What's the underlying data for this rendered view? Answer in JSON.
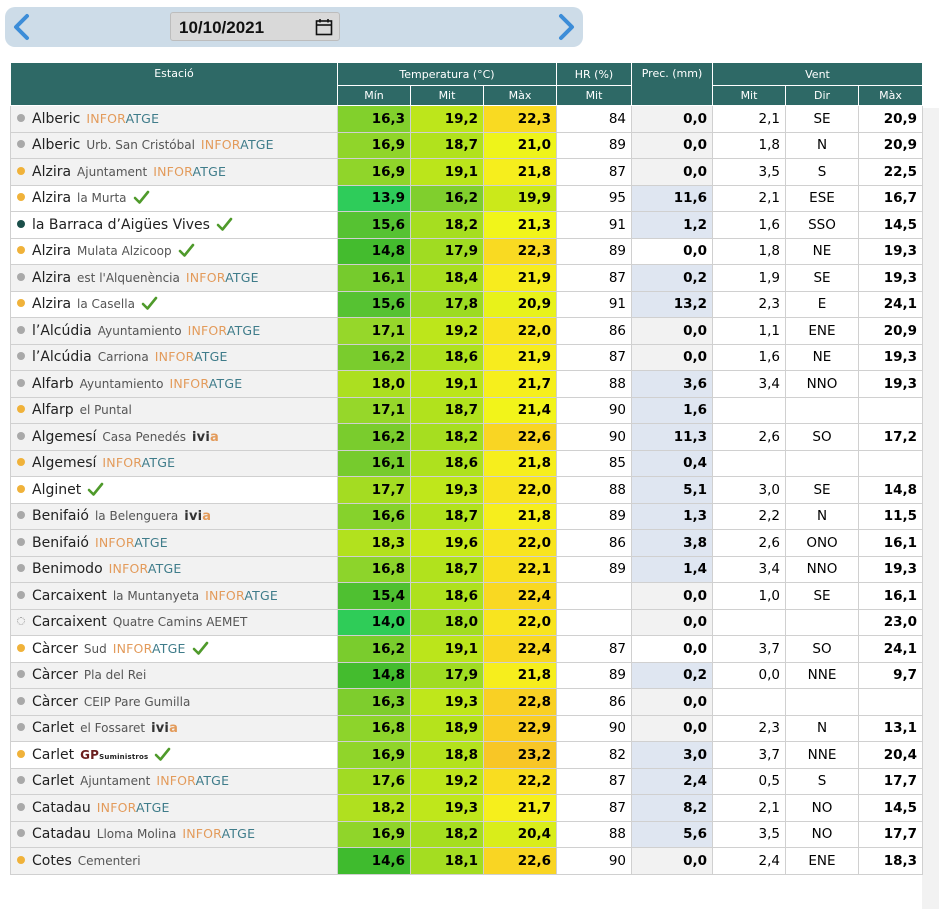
{
  "date_picker": {
    "value": "10/10/2021",
    "prev_icon": "chevron-left-icon",
    "next_icon": "chevron-right-icon",
    "calendar_icon": "calendar-icon"
  },
  "colors": {
    "header": "#2e6966",
    "dot_grey": "#a9a9a9",
    "dot_orange": "#f0b23a",
    "dot_teal": "#1b4f4a",
    "check": "#4f9a2b",
    "prec_bg": "#dfe6f1"
  },
  "table": {
    "headers": {
      "station": "Estació",
      "temp": "Temperatura (°C)",
      "hr": "HR (%)",
      "prec": "Prec. (mm)",
      "wind": "Vent"
    },
    "subheaders": {
      "tmin": "Mín",
      "tmid": "Mit",
      "tmax": "Màx",
      "hr_mid": "Mit",
      "wind_mid": "Mit",
      "wind_dir": "Dir",
      "wind_max": "Màx"
    },
    "rows": [
      {
        "name": "Alberic",
        "sub": "",
        "net": "infor",
        "check": false,
        "dot": "grey",
        "tmin": "16,3",
        "tmid": "19,2",
        "tmax": "22,3",
        "hr": "84",
        "prec": "0,0",
        "wmid": "2,1",
        "wdir": "SE",
        "wmax": "20,9",
        "tmin_bg": "#82d02c",
        "tmid_bg": "#bde61b",
        "tmax_bg": "#f9da22",
        "prec_hl": false
      },
      {
        "name": "Alberic",
        "sub": "Urb. San Cristóbal",
        "net": "infor",
        "check": false,
        "dot": "grey",
        "tmin": "16,9",
        "tmid": "18,7",
        "tmax": "21,0",
        "hr": "89",
        "prec": "0,0",
        "wmid": "1,8",
        "wdir": "N",
        "wmax": "20,9",
        "tmin_bg": "#90d52a",
        "tmid_bg": "#b1e21d",
        "tmax_bg": "#eef41a",
        "prec_hl": false
      },
      {
        "name": "Alzira",
        "sub": "Ajuntament",
        "net": "infor",
        "check": false,
        "dot": "orange",
        "tmin": "16,9",
        "tmid": "19,1",
        "tmax": "21,8",
        "hr": "87",
        "prec": "0,0",
        "wmid": "3,5",
        "wdir": "S",
        "wmax": "22,5",
        "tmin_bg": "#90d52a",
        "tmid_bg": "#bbe51b",
        "tmax_bg": "#f6ee1d",
        "prec_hl": false
      },
      {
        "name": "Alzira",
        "sub": "la Murta",
        "net": "",
        "check": true,
        "dot": "orange",
        "tmin": "13,9",
        "tmid": "16,2",
        "tmax": "19,9",
        "hr": "95",
        "prec": "11,6",
        "wmid": "2,1",
        "wdir": "ESE",
        "wmax": "16,7",
        "tmin_bg": "#2ecc5a",
        "tmid_bg": "#80cf2d",
        "tmax_bg": "#cbe91a",
        "prec_hl": true
      },
      {
        "name": "la Barraca d’Aigües Vives",
        "sub": "",
        "net": "",
        "check": true,
        "dot": "teal",
        "tmin": "15,6",
        "tmid": "18,2",
        "tmax": "21,3",
        "hr": "91",
        "prec": "1,2",
        "wmid": "1,6",
        "wdir": "SSO",
        "wmax": "14,5",
        "tmin_bg": "#56c232",
        "tmid_bg": "#a6de20",
        "tmax_bg": "#f1f51a",
        "prec_hl": true
      },
      {
        "name": "Alzira",
        "sub": "Mulata Alzicoop",
        "net": "",
        "check": true,
        "dot": "orange",
        "tmin": "14,8",
        "tmid": "17,9",
        "tmax": "22,3",
        "hr": "89",
        "prec": "0,0",
        "wmid": "1,8",
        "wdir": "NE",
        "wmax": "19,3",
        "tmin_bg": "#44bc2e",
        "tmid_bg": "#a0dc22",
        "tmax_bg": "#f9da22",
        "prec_hl": false
      },
      {
        "name": "Alzira",
        "sub": "est l'Alquenència",
        "net": "infor",
        "check": false,
        "dot": "grey",
        "tmin": "16,1",
        "tmid": "18,4",
        "tmax": "21,9",
        "hr": "87",
        "prec": "0,2",
        "wmid": "1,9",
        "wdir": "SE",
        "wmax": "19,3",
        "tmin_bg": "#76cb2d",
        "tmid_bg": "#a9df1f",
        "tmax_bg": "#f7ec1e",
        "prec_hl": true
      },
      {
        "name": "Alzira",
        "sub": "la Casella",
        "net": "",
        "check": true,
        "dot": "orange",
        "tmin": "15,6",
        "tmid": "17,8",
        "tmax": "20,9",
        "hr": "91",
        "prec": "13,2",
        "wmid": "2,3",
        "wdir": "E",
        "wmax": "24,1",
        "tmin_bg": "#56c232",
        "tmid_bg": "#9cdb22",
        "tmax_bg": "#e8f21a",
        "prec_hl": true
      },
      {
        "name": "l’Alcúdia",
        "sub": "Ayuntamiento",
        "net": "infor",
        "check": false,
        "dot": "grey",
        "tmin": "17,1",
        "tmid": "19,2",
        "tmax": "22,0",
        "hr": "86",
        "prec": "0,0",
        "wmid": "1,1",
        "wdir": "ENE",
        "wmax": "20,9",
        "tmin_bg": "#96d72a",
        "tmid_bg": "#bde61b",
        "tmax_bg": "#f8e41f",
        "prec_hl": false
      },
      {
        "name": "l’Alcúdia",
        "sub": "Carriona",
        "net": "infor",
        "check": false,
        "dot": "grey",
        "tmin": "16,2",
        "tmid": "18,6",
        "tmax": "21,9",
        "hr": "87",
        "prec": "0,0",
        "wmid": "1,6",
        "wdir": "NE",
        "wmax": "19,3",
        "tmin_bg": "#7acc2d",
        "tmid_bg": "#aee11e",
        "tmax_bg": "#f7ec1e",
        "prec_hl": false
      },
      {
        "name": "Alfarb",
        "sub": "Ayuntamiento",
        "net": "infor",
        "check": false,
        "dot": "grey",
        "tmin": "18,0",
        "tmid": "19,1",
        "tmax": "21,7",
        "hr": "88",
        "prec": "3,6",
        "wmid": "3,4",
        "wdir": "NNO",
        "wmax": "19,3",
        "tmin_bg": "#acdf20",
        "tmid_bg": "#bbe51b",
        "tmax_bg": "#f6ef1c",
        "prec_hl": true
      },
      {
        "name": "Alfarp",
        "sub": "el Puntal",
        "net": "",
        "check": false,
        "dot": "orange",
        "tmin": "17,1",
        "tmid": "18,7",
        "tmax": "21,4",
        "hr": "90",
        "prec": "1,6",
        "wmid": "",
        "wdir": "",
        "wmax": "",
        "tmin_bg": "#96d72a",
        "tmid_bg": "#b1e21d",
        "tmax_bg": "#f2f41a",
        "prec_hl": true
      },
      {
        "name": "Algemesí",
        "sub": "Casa Penedés",
        "net": "ivia",
        "check": false,
        "dot": "grey",
        "tmin": "16,2",
        "tmid": "18,2",
        "tmax": "22,6",
        "hr": "90",
        "prec": "11,3",
        "wmid": "2,6",
        "wdir": "SO",
        "wmax": "17,2",
        "tmin_bg": "#7acc2d",
        "tmid_bg": "#a6de20",
        "tmax_bg": "#f9d523",
        "prec_hl": true
      },
      {
        "name": "Algemesí",
        "sub": "",
        "net": "infor",
        "check": false,
        "dot": "orange",
        "tmin": "16,1",
        "tmid": "18,6",
        "tmax": "21,8",
        "hr": "85",
        "prec": "0,4",
        "wmid": "",
        "wdir": "",
        "wmax": "",
        "tmin_bg": "#76cb2d",
        "tmid_bg": "#aee11e",
        "tmax_bg": "#f6ee1d",
        "prec_hl": true
      },
      {
        "name": "Alginet",
        "sub": "",
        "net": "",
        "check": true,
        "dot": "orange",
        "tmin": "17,7",
        "tmid": "19,3",
        "tmax": "22,0",
        "hr": "88",
        "prec": "5,1",
        "wmid": "3,0",
        "wdir": "SE",
        "wmax": "14,8",
        "tmin_bg": "#a4dc22",
        "tmid_bg": "#bfe71b",
        "tmax_bg": "#f8e41f",
        "prec_hl": true
      },
      {
        "name": "Benifaió",
        "sub": "la Belenguera",
        "net": "ivia",
        "check": false,
        "dot": "grey",
        "tmin": "16,6",
        "tmid": "18,7",
        "tmax": "21,8",
        "hr": "89",
        "prec": "1,3",
        "wmid": "2,2",
        "wdir": "N",
        "wmax": "11,5",
        "tmin_bg": "#86d22c",
        "tmid_bg": "#b1e21d",
        "tmax_bg": "#f6ee1d",
        "prec_hl": true
      },
      {
        "name": "Benifaió",
        "sub": "",
        "net": "infor",
        "check": false,
        "dot": "grey",
        "tmin": "18,3",
        "tmid": "19,6",
        "tmax": "22,0",
        "hr": "86",
        "prec": "3,8",
        "wmid": "2,6",
        "wdir": "ONO",
        "wmax": "16,1",
        "tmin_bg": "#b2e11e",
        "tmid_bg": "#c8e91a",
        "tmax_bg": "#f8e41f",
        "prec_hl": true
      },
      {
        "name": "Benimodo",
        "sub": "",
        "net": "infor",
        "check": false,
        "dot": "grey",
        "tmin": "16,8",
        "tmid": "18,7",
        "tmax": "22,1",
        "hr": "89",
        "prec": "1,4",
        "wmid": "3,4",
        "wdir": "NNO",
        "wmax": "19,3",
        "tmin_bg": "#8dd42b",
        "tmid_bg": "#b1e21d",
        "tmax_bg": "#f8e01f",
        "prec_hl": true
      },
      {
        "name": "Carcaixent",
        "sub": "la Muntanyeta",
        "net": "infor",
        "check": false,
        "dot": "grey",
        "tmin": "15,4",
        "tmid": "18,6",
        "tmax": "22,4",
        "hr": "",
        "prec": "0,0",
        "wmid": "1,0",
        "wdir": "SE",
        "wmax": "16,1",
        "tmin_bg": "#4fc031",
        "tmid_bg": "#aee11e",
        "tmax_bg": "#f9d822",
        "prec_hl": false
      },
      {
        "name": "Carcaixent",
        "sub": "Quatre Camins AEMET",
        "net": "",
        "check": false,
        "dot": "hollow",
        "tmin": "14,0",
        "tmid": "18,0",
        "tmax": "22,0",
        "hr": "",
        "prec": "0,0",
        "wmid": "",
        "wdir": "",
        "wmax": "23,0",
        "tmin_bg": "#2fcc58",
        "tmid_bg": "#a2dd21",
        "tmax_bg": "#f8e41f",
        "prec_hl": false
      },
      {
        "name": "Càrcer",
        "sub": "Sud",
        "net": "infor",
        "check": true,
        "dot": "orange",
        "tmin": "16,2",
        "tmid": "19,1",
        "tmax": "22,4",
        "hr": "87",
        "prec": "0,0",
        "wmid": "3,7",
        "wdir": "SO",
        "wmax": "24,1",
        "tmin_bg": "#7acc2d",
        "tmid_bg": "#bbe51b",
        "tmax_bg": "#f9d822",
        "prec_hl": false
      },
      {
        "name": "Càrcer",
        "sub": "Pla del Rei",
        "net": "",
        "check": false,
        "dot": "grey",
        "tmin": "14,8",
        "tmid": "17,9",
        "tmax": "21,8",
        "hr": "89",
        "prec": "0,2",
        "wmid": "0,0",
        "wdir": "NNE",
        "wmax": "9,7",
        "tmin_bg": "#44bc2e",
        "tmid_bg": "#a0dc22",
        "tmax_bg": "#f6ee1d",
        "prec_hl": true
      },
      {
        "name": "Càrcer",
        "sub": "CEIP Pare Gumilla",
        "net": "",
        "check": false,
        "dot": "grey",
        "tmin": "16,3",
        "tmid": "19,3",
        "tmax": "22,8",
        "hr": "86",
        "prec": "0,0",
        "wmid": "",
        "wdir": "",
        "wmax": "",
        "tmin_bg": "#7ecd2d",
        "tmid_bg": "#bfe71b",
        "tmax_bg": "#f9d024",
        "prec_hl": false
      },
      {
        "name": "Carlet",
        "sub": "el Fossaret",
        "net": "ivia",
        "check": false,
        "dot": "grey",
        "tmin": "16,8",
        "tmid": "18,9",
        "tmax": "22,9",
        "hr": "90",
        "prec": "0,0",
        "wmid": "2,3",
        "wdir": "N",
        "wmax": "13,1",
        "tmin_bg": "#8dd42b",
        "tmid_bg": "#b5e31c",
        "tmax_bg": "#f9ce24",
        "prec_hl": false
      },
      {
        "name": "Carlet",
        "sub": "",
        "net": "gp",
        "check": true,
        "dot": "orange",
        "tmin": "16,9",
        "tmid": "18,8",
        "tmax": "23,2",
        "hr": "82",
        "prec": "3,0",
        "wmid": "3,7",
        "wdir": "NNE",
        "wmax": "20,4",
        "tmin_bg": "#90d52a",
        "tmid_bg": "#b3e21d",
        "tmax_bg": "#f8c626",
        "prec_hl": true
      },
      {
        "name": "Carlet",
        "sub": "Ajuntament",
        "net": "infor",
        "check": false,
        "dot": "grey",
        "tmin": "17,6",
        "tmid": "19,2",
        "tmax": "22,2",
        "hr": "87",
        "prec": "2,4",
        "wmid": "0,5",
        "wdir": "S",
        "wmax": "17,7",
        "tmin_bg": "#a1db23",
        "tmid_bg": "#bde61b",
        "tmax_bg": "#f9dd20",
        "prec_hl": true
      },
      {
        "name": "Catadau",
        "sub": "",
        "net": "infor",
        "check": false,
        "dot": "grey",
        "tmin": "18,2",
        "tmid": "19,3",
        "tmax": "21,7",
        "hr": "87",
        "prec": "8,2",
        "wmid": "2,1",
        "wdir": "NO",
        "wmax": "14,5",
        "tmin_bg": "#b0e01f",
        "tmid_bg": "#bfe71b",
        "tmax_bg": "#f6ef1c",
        "prec_hl": true
      },
      {
        "name": "Catadau",
        "sub": "Lloma Molina",
        "net": "infor",
        "check": false,
        "dot": "grey",
        "tmin": "16,9",
        "tmid": "18,2",
        "tmax": "20,4",
        "hr": "88",
        "prec": "5,6",
        "wmid": "3,5",
        "wdir": "NO",
        "wmax": "17,7",
        "tmin_bg": "#90d52a",
        "tmid_bg": "#a6de20",
        "tmax_bg": "#d9ed1a",
        "prec_hl": true
      },
      {
        "name": "Cotes",
        "sub": "Cementeri",
        "net": "",
        "check": false,
        "dot": "orange",
        "tmin": "14,6",
        "tmid": "18,1",
        "tmax": "22,6",
        "hr": "90",
        "prec": "0,0",
        "wmid": "2,4",
        "wdir": "ENE",
        "wmax": "18,3",
        "tmin_bg": "#3fbb2e",
        "tmid_bg": "#a4dd21",
        "tmax_bg": "#f9d523",
        "prec_hl": false
      }
    ]
  },
  "network_labels": {
    "infor_a": "INFOR",
    "infor_b": "ATGE",
    "ivia_a": "ivi",
    "ivia_b": "a",
    "gp": "GP",
    "gp_small": "Suministros"
  }
}
